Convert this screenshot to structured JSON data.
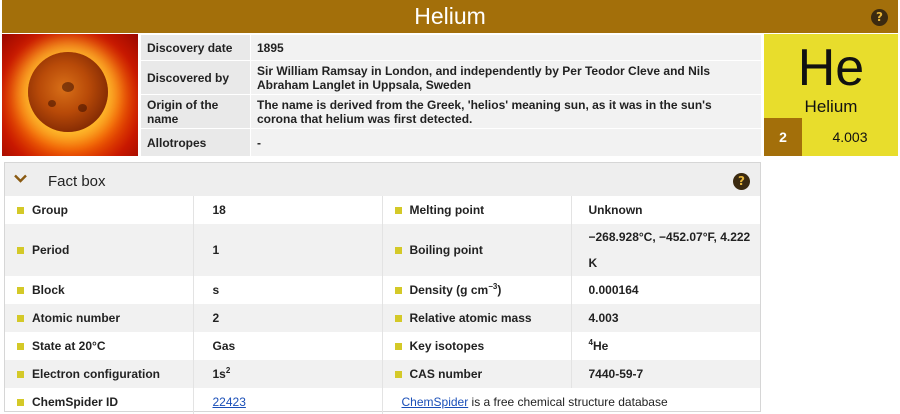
{
  "header": {
    "title": "Helium",
    "help_icon": "question-circle-icon"
  },
  "discovery": [
    {
      "label": "Discovery date",
      "value": "1895"
    },
    {
      "label": "Discovered by",
      "value": "Sir William Ramsay in London, and independently by Per Teodor Cleve and Nils Abraham Langlet in Uppsala, Sweden"
    },
    {
      "label": "Origin of the name",
      "value": "The name is derived from the Greek, 'helios' meaning sun, as it was in the sun's corona that helium was first detected."
    },
    {
      "label": "Allotropes",
      "value": "-"
    }
  ],
  "element": {
    "symbol": "He",
    "name": "Helium",
    "atomic_number": "2",
    "mass": "4.003"
  },
  "fact_box": {
    "title": "Fact box",
    "rows": [
      {
        "l1": "Group",
        "v1": "18",
        "l2": "Melting point",
        "v2": "Unknown"
      },
      {
        "l1": "Period",
        "v1": "1",
        "l2": "Boiling point",
        "v2": "−268.928°C, −452.07°F, 4.222 K"
      },
      {
        "l1": "Block",
        "v1": "s",
        "l2_main": "Density (g cm",
        "l2_sup": "−3",
        "l2_end": ")",
        "v2": "0.000164"
      },
      {
        "l1": "Atomic number",
        "v1": "2",
        "l2": "Relative atomic mass",
        "v2": "4.003"
      },
      {
        "l1": "State at 20°C",
        "v1": "Gas",
        "l2": "Key isotopes",
        "v2_sup": "4",
        "v2_main": "He"
      },
      {
        "l1": "Electron configuration",
        "v1_main": "1s",
        "v1_sup": "2",
        "l2": "CAS number",
        "v2": "7440-59-7"
      },
      {
        "l1": "ChemSpider ID",
        "v1_link": "22423",
        "note_link": "ChemSpider",
        "note_text": " is a free chemical structure database"
      }
    ]
  },
  "colors": {
    "header_bg": "#a36f0a",
    "element_bg": "#e8dd2c",
    "bullet": "#d4c928",
    "link": "#1a4fb8"
  }
}
